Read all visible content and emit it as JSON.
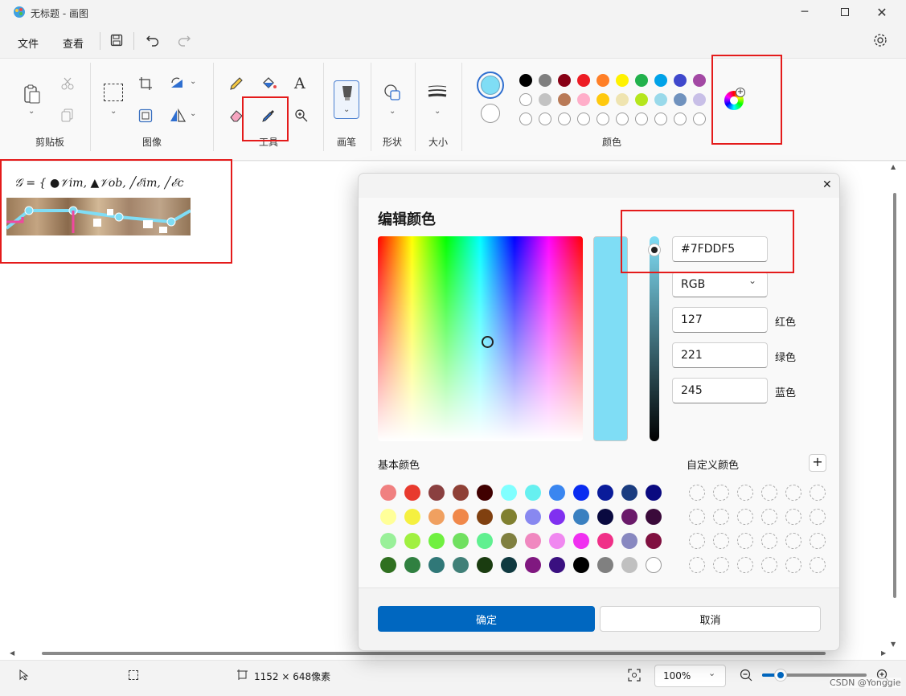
{
  "window": {
    "title": "无标题 - 画图"
  },
  "menu": {
    "file": "文件",
    "view": "查看"
  },
  "ribbon": {
    "clipboard": "剪贴板",
    "image": "图像",
    "tools": "工具",
    "brushes": "画笔",
    "shapes": "形状",
    "size": "大小",
    "colors": "颜色"
  },
  "ribbon_colors": {
    "primary": "#7FDDF5",
    "secondary": "#FFFFFF",
    "row1": [
      "#000000",
      "#7f7f7f",
      "#880015",
      "#ed1c24",
      "#ff7f27",
      "#fff200",
      "#22b14c",
      "#00a2e8",
      "#3f48cc",
      "#a349a4"
    ],
    "row2": [
      "#ffffff",
      "#c3c3c3",
      "#b97a57",
      "#ffaec9",
      "#ffc90e",
      "#efe4b0",
      "#b5e61d",
      "#99d9ea",
      "#7092be",
      "#c8bfe7"
    ]
  },
  "canvas": {
    "formula": "𝒢 = { ●𝒱im, ▲𝒱ob, ╱ℰim, ╱ℰc"
  },
  "dialog": {
    "title": "编辑颜色",
    "hex": "#7FDDF5",
    "mode": "RGB",
    "red": "127",
    "green": "221",
    "blue": "245",
    "red_label": "红色",
    "green_label": "绿色",
    "blue_label": "蓝色",
    "basic_colors_label": "基本颜色",
    "custom_colors_label": "自定义颜色",
    "ok": "确定",
    "cancel": "取消",
    "current_color": "#7FDDF5",
    "basic_colors": [
      [
        "#f08080",
        "#e83a2e",
        "#8a4040",
        "#8f4036",
        "#400000",
        "#80ffff",
        "#66f0f0",
        "#3a86f0",
        "#0a2cf0",
        "#0a1c9a",
        "#1a3c80",
        "#0a0a80"
      ],
      [
        "#ffff99",
        "#f5f040",
        "#f0a060",
        "#f0884a",
        "#804010",
        "#808030",
        "#8888f0",
        "#8030f0",
        "#3a80c0",
        "#0a0a40",
        "#6a1a6a",
        "#3a0a3a"
      ],
      [
        "#99f099",
        "#a0f040",
        "#70f040",
        "#70e060",
        "#60f090",
        "#808040",
        "#f088c0",
        "#f088f0",
        "#f030f0",
        "#f03088",
        "#8888c0",
        "#801040"
      ],
      [
        "#307020",
        "#308040",
        "#307878",
        "#408078",
        "#1a3c10",
        "#103a40",
        "#801880",
        "#3a1080",
        "#000000",
        "#808080",
        "#c0c0c0",
        "#ffffff"
      ]
    ]
  },
  "status": {
    "dimensions": "1152 × 648像素",
    "zoom": "100%",
    "watermark": "CSDN @Yonggie"
  }
}
